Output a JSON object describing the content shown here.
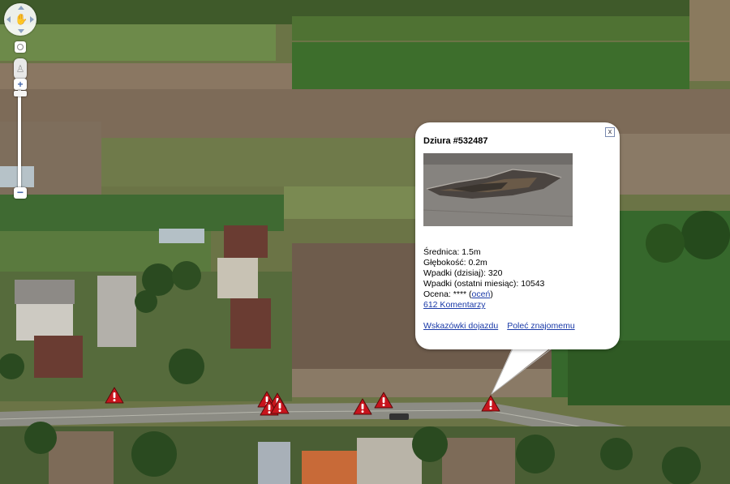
{
  "map": {
    "controls": {
      "pan_icon": "hand-pan-icon",
      "reset_icon": "circle-icon",
      "pegman_icon": "pegman-icon",
      "zoom_in_label": "+",
      "zoom_out_label": "−"
    },
    "markers": [
      {
        "icon": "warning-marker-icon"
      },
      {
        "icon": "warning-marker-icon"
      },
      {
        "icon": "warning-marker-icon"
      },
      {
        "icon": "warning-marker-icon"
      },
      {
        "icon": "warning-marker-icon"
      },
      {
        "icon": "warning-marker-icon"
      },
      {
        "icon": "warning-marker-icon"
      },
      {
        "icon": "warning-marker-icon"
      }
    ],
    "colors": {
      "marker": "#c8141c",
      "link": "#1a3aa8"
    }
  },
  "infowindow": {
    "title": "Dziura #532487",
    "close_label": "x",
    "diameter": "Średnica: 1.5m",
    "depth": "Głębokość: 0.2m",
    "incidents_today": "Wpadki (dzisiaj): 320",
    "incidents_month": "Wpadki (ostatni miesiąc): 10543",
    "rating_prefix": "Ocena: **** (",
    "rating_link": "oceń",
    "rating_suffix": ")",
    "comments_link": "612 Komentarzy",
    "directions_link": "Wskazówki dojazdu",
    "recommend_link": "Poleć znajomemu"
  }
}
